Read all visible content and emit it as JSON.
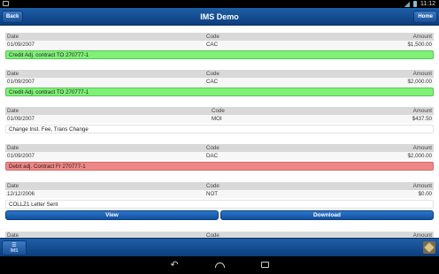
{
  "status_bar": {
    "time": "11:12"
  },
  "header": {
    "title": "IMS Demo",
    "back_label": "Back",
    "home_label": "Home"
  },
  "columns": {
    "date": "Date",
    "code": "Code",
    "amount": "Amount"
  },
  "records": [
    {
      "date": "01/09/2007",
      "code": "CAC",
      "amount": "$1,500.00",
      "note": "Credit Adj. contract TO 270777-1",
      "note_style": "green"
    },
    {
      "date": "01/09/2007",
      "code": "CAC",
      "amount": "$2,000.00",
      "note": "Credit Adj. contract TO 270777-1",
      "note_style": "green"
    },
    {
      "date": "01/09/2007",
      "code": "MOI",
      "amount": "$437.50",
      "note": "Change Inst. Fee, Trans Change",
      "note_style": "plain"
    },
    {
      "date": "01/09/2007",
      "code": "DAC",
      "amount": "$2,000.00",
      "note": "Debit adj. Contract Fr 270777-1",
      "note_style": "red"
    },
    {
      "date": "12/12/2006",
      "code": "NOT",
      "amount": "$0.00",
      "note": "COLLZ1 Letter Sent",
      "note_style": "plain",
      "view_label": "View",
      "download_label": "Download"
    },
    {
      "date": "",
      "code": "",
      "amount": ""
    }
  ],
  "footer": {
    "tab_label": "IMS"
  },
  "colors": {
    "header_blue": "#1f5fa6",
    "credit_green": "#7ef176",
    "debit_red": "#f08787",
    "button_blue": "#2e76cc"
  },
  "icons": {
    "nav_back": "back-arrow-icon",
    "nav_home": "home-icon",
    "nav_recent": "recent-apps-icon"
  }
}
